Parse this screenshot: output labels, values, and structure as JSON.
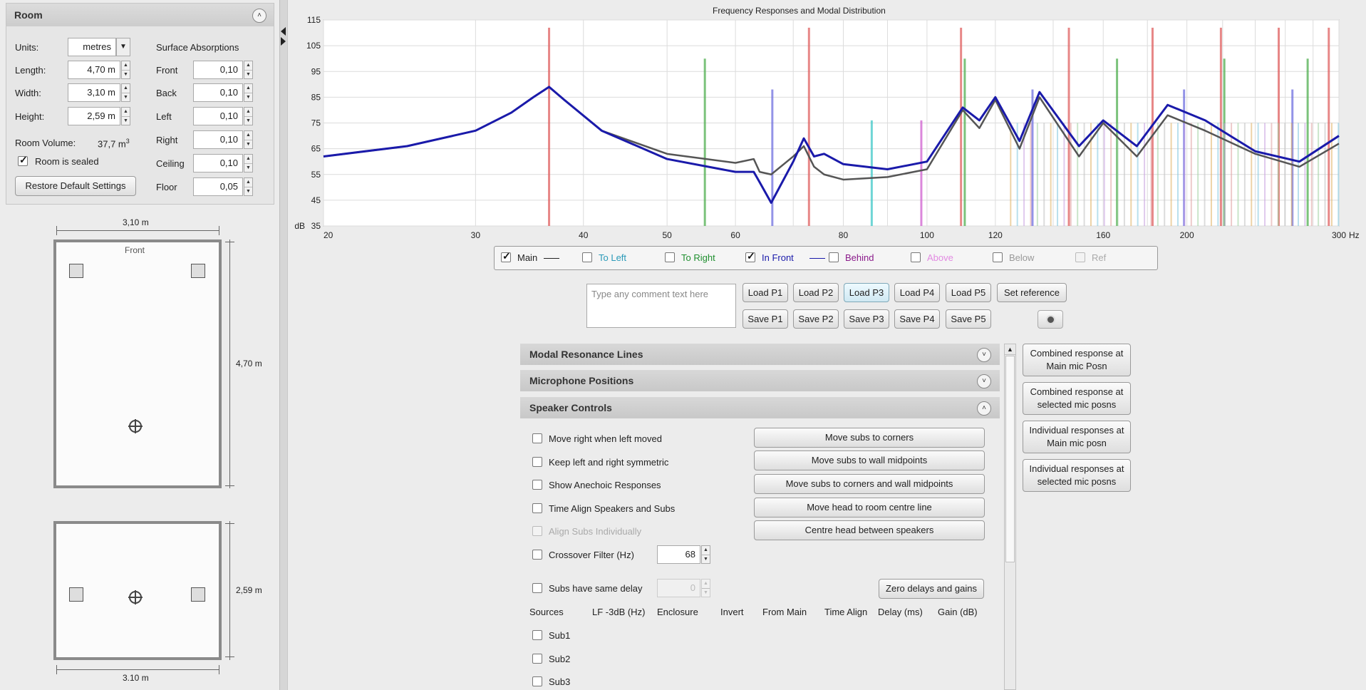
{
  "room": {
    "title": "Room",
    "units_label": "Units:",
    "units_value": "metres",
    "length_label": "Length:",
    "length_value": "4,70 m",
    "width_label": "Width:",
    "width_value": "3,10 m",
    "height_label": "Height:",
    "height_value": "2,59 m",
    "volume_label": "Room Volume:",
    "volume_value": "37,7 m",
    "volume_unit_sup": "3",
    "sealed_label": "Room is sealed",
    "sealed_checked": true,
    "restore_button": "Restore Default Settings",
    "absorptions_title": "Surface Absorptions",
    "absorptions": [
      {
        "label": "Front",
        "value": "0,10"
      },
      {
        "label": "Back",
        "value": "0,10"
      },
      {
        "label": "Left",
        "value": "0,10"
      },
      {
        "label": "Right",
        "value": "0,10"
      },
      {
        "label": "Ceiling",
        "value": "0,10"
      },
      {
        "label": "Floor",
        "value": "0,05"
      }
    ]
  },
  "plan_view": {
    "width_dim": "3,10 m",
    "length_dim": "4,70 m",
    "front_label": "Front"
  },
  "elevation_view": {
    "height_dim": "2,59 m",
    "width_dim": "3.10 m"
  },
  "chart_data": {
    "type": "line",
    "title": "Frequency Responses and Modal Distribution",
    "ylabel": "dB",
    "x_unit_label": "Hz",
    "xscale": "log",
    "xlim": [
      20,
      300
    ],
    "ylim": [
      35,
      115
    ],
    "x_ticks": [
      20,
      30,
      40,
      50,
      60,
      80,
      100,
      120,
      160,
      200,
      300
    ],
    "y_ticks": [
      35,
      45,
      55,
      65,
      75,
      85,
      95,
      105,
      115
    ],
    "grid": true,
    "series": [
      {
        "name": "Main",
        "color": "#555555",
        "x": [
          20,
          25,
          30,
          33,
          35,
          36.5,
          38,
          42,
          50,
          60,
          63,
          64,
          66,
          70,
          72,
          74,
          76,
          80,
          90,
          100,
          110,
          115,
          120,
          128,
          135,
          150,
          160,
          175,
          190,
          210,
          240,
          270,
          300
        ],
        "y": [
          62,
          66,
          72,
          79,
          85,
          89,
          84,
          72,
          63,
          59.5,
          61,
          56,
          55,
          62,
          66,
          58,
          55,
          53,
          54,
          57,
          80,
          73,
          84,
          65,
          85,
          62,
          75,
          62,
          78,
          72,
          63,
          58,
          67
        ]
      },
      {
        "name": "In Front",
        "color": "#1a1aaa",
        "x": [
          20,
          25,
          30,
          33,
          35,
          36.5,
          38,
          42,
          50,
          60,
          63,
          64,
          66,
          70,
          72,
          74,
          76,
          80,
          90,
          100,
          110,
          115,
          120,
          128,
          135,
          150,
          160,
          175,
          190,
          210,
          240,
          270,
          300
        ],
        "y": [
          62,
          66,
          72,
          79,
          85,
          89,
          84,
          72,
          61,
          56,
          56,
          52,
          44,
          60,
          69,
          62,
          63,
          59,
          57,
          60,
          81,
          76,
          85,
          68,
          87,
          66,
          76,
          66,
          82,
          76,
          64,
          60,
          70
        ]
      }
    ],
    "modal_lines_hz": [
      {
        "hz": 36.5,
        "level": 112,
        "color": "#e06060"
      },
      {
        "hz": 55.3,
        "level": 100,
        "color": "#50b050"
      },
      {
        "hz": 66.2,
        "level": 88,
        "color": "#7070e0"
      },
      {
        "hz": 73,
        "level": 112,
        "color": "#e06060"
      },
      {
        "hz": 86.3,
        "level": 76,
        "color": "#40c8c8"
      },
      {
        "hz": 98.5,
        "level": 76,
        "color": "#d060d0"
      },
      {
        "hz": 109.5,
        "level": 112,
        "color": "#e06060"
      },
      {
        "hz": 110.6,
        "level": 100,
        "color": "#50b050"
      },
      {
        "hz": 132.5,
        "level": 88,
        "color": "#7070e0"
      },
      {
        "hz": 146,
        "level": 112,
        "color": "#e06060"
      },
      {
        "hz": 166,
        "level": 100,
        "color": "#50b050"
      },
      {
        "hz": 182.5,
        "level": 112,
        "color": "#e06060"
      },
      {
        "hz": 198.5,
        "level": 88,
        "color": "#7070e0"
      },
      {
        "hz": 219,
        "level": 112,
        "color": "#e06060"
      },
      {
        "hz": 221,
        "level": 100,
        "color": "#50b050"
      },
      {
        "hz": 255.5,
        "level": 112,
        "color": "#e06060"
      },
      {
        "hz": 265,
        "level": 88,
        "color": "#7070e0"
      },
      {
        "hz": 276,
        "level": 100,
        "color": "#50b050"
      },
      {
        "hz": 292,
        "level": 112,
        "color": "#e06060"
      }
    ]
  },
  "legend": [
    {
      "label": "Main",
      "checked": true,
      "color": "#222222",
      "line": true,
      "dim": false
    },
    {
      "label": "To Left",
      "checked": false,
      "color": "#2a9ab8",
      "line": false,
      "dim": false
    },
    {
      "label": "To Right",
      "checked": false,
      "color": "#1f8f2f",
      "line": false,
      "dim": false
    },
    {
      "label": "In Front",
      "checked": true,
      "color": "#1a1aaa",
      "line": true,
      "dim": false
    },
    {
      "label": "Behind",
      "checked": false,
      "color": "#8a1a8a",
      "line": false,
      "dim": false
    },
    {
      "label": "Above",
      "checked": false,
      "color": "#e28ae2",
      "line": false,
      "dim": false
    },
    {
      "label": "Below",
      "checked": false,
      "color": "#999999",
      "line": false,
      "dim": false
    },
    {
      "label": "Ref",
      "checked": false,
      "color": "#aaaaaa",
      "line": false,
      "dim": true
    }
  ],
  "comment_placeholder": "Type any comment text here",
  "presets": {
    "load": [
      "Load P1",
      "Load P2",
      "Load P3",
      "Load P4",
      "Load P5"
    ],
    "save": [
      "Save P1",
      "Save P2",
      "Save P3",
      "Save P4",
      "Save P5"
    ],
    "set_reference": "Set reference"
  },
  "accordion": {
    "modal": "Modal Resonance Lines",
    "mic": "Microphone Positions",
    "speaker": "Speaker Controls"
  },
  "speaker_controls": {
    "checkboxes": [
      {
        "label": "Move right when left moved",
        "dim": false
      },
      {
        "label": "Keep left and right symmetric",
        "dim": false
      },
      {
        "label": "Show Anechoic Responses",
        "dim": false
      },
      {
        "label": "Time Align Speakers and Subs",
        "dim": false
      },
      {
        "label": "Align Subs Individually",
        "dim": true
      }
    ],
    "buttons": [
      "Move subs to corners",
      "Move subs to wall midpoints",
      "Move subs to corners and wall midpoints",
      "Move head to room centre line",
      "Centre head between speakers"
    ],
    "crossover_label": "Crossover Filter (Hz)",
    "crossover_value": "68",
    "same_delay_label": "Subs have same delay",
    "same_delay_value": "0",
    "zero_button": "Zero delays and gains",
    "columns": [
      "Sources",
      "LF -3dB (Hz)",
      "Enclosure",
      "Invert",
      "From Main",
      "Time Align",
      "Delay (ms)",
      "Gain (dB)"
    ],
    "subs": [
      "Sub1",
      "Sub2",
      "Sub3"
    ]
  },
  "side_buttons": [
    {
      "line1": "Combined response at",
      "line2": "Main mic Posn"
    },
    {
      "line1": "Combined response at",
      "line2": "selected mic posns"
    },
    {
      "line1": "Individual responses at",
      "line2": "Main mic posn"
    },
    {
      "line1": "Individual responses at",
      "line2": "selected mic posns"
    }
  ]
}
